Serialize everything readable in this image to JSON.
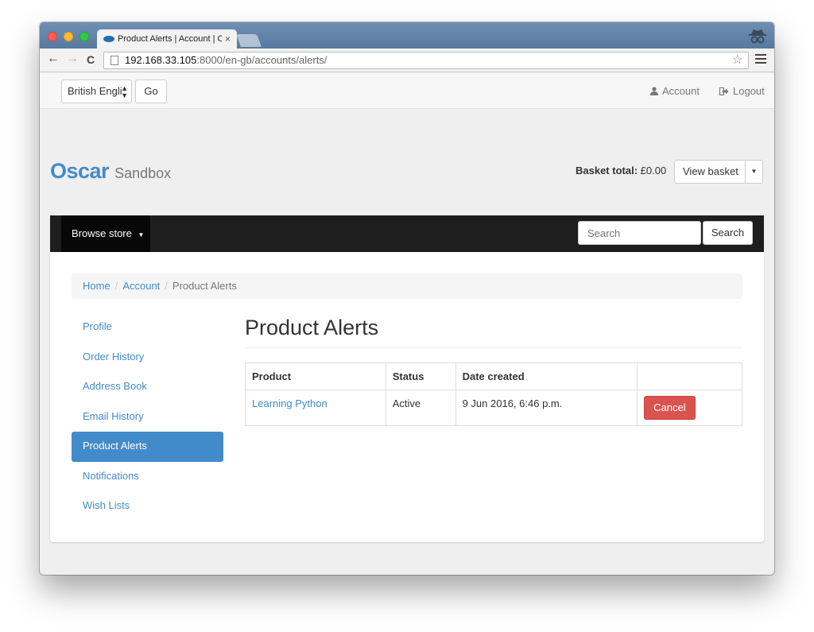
{
  "browser": {
    "tab_title": "Product Alerts | Account | O",
    "tab_close": "×",
    "url_host": "192.168.33.105",
    "url_rest": ":8000/en-gb/accounts/alerts/",
    "back_icon": "←",
    "forward_icon": "→",
    "reload_icon": "C",
    "star_icon": "☆"
  },
  "topnav": {
    "language": "British Engli",
    "language_arrows": "▲▼",
    "go_label": "Go",
    "account_label": "Account",
    "logout_label": "Logout"
  },
  "header": {
    "brand_name": "Oscar",
    "brand_sub": "Sandbox",
    "basket_total_label": "Basket total:",
    "basket_total_value": "£0.00",
    "view_basket_label": "View basket"
  },
  "navbar": {
    "browse_label": "Browse store",
    "search_placeholder": "Search",
    "search_button": "Search"
  },
  "breadcrumb": {
    "items": [
      "Home",
      "Account",
      "Product Alerts"
    ],
    "separator": "/"
  },
  "sidenav": {
    "items": [
      {
        "label": "Profile"
      },
      {
        "label": "Order History"
      },
      {
        "label": "Address Book"
      },
      {
        "label": "Email History"
      },
      {
        "label": "Product Alerts"
      },
      {
        "label": "Notifications"
      },
      {
        "label": "Wish Lists"
      }
    ]
  },
  "main": {
    "title": "Product Alerts",
    "columns": [
      "Product",
      "Status",
      "Date created",
      ""
    ],
    "rows": [
      {
        "product": "Learning Python",
        "status": "Active",
        "date": "9 Jun 2016, 6:46 p.m.",
        "action": "Cancel"
      }
    ]
  },
  "colors": {
    "accent": "#428bca",
    "danger": "#d9534f",
    "navbar_bg": "#1e1e1e"
  }
}
